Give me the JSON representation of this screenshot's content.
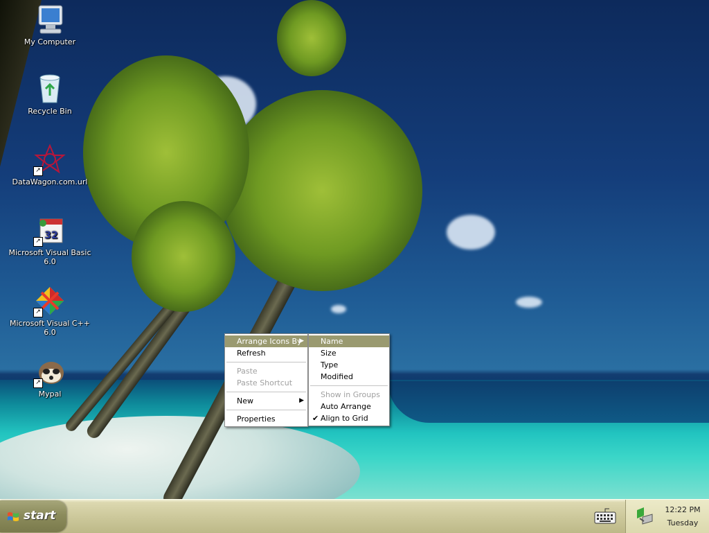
{
  "desktop": {
    "icons": [
      {
        "label": "My Computer",
        "icon": "my-computer-icon",
        "shortcut": false
      },
      {
        "label": "Recycle Bin",
        "icon": "recycle-bin-icon",
        "shortcut": false
      },
      {
        "label": "DataWagon.com.url",
        "icon": "datawagon-icon",
        "shortcut": true
      },
      {
        "label": "Microsoft Visual Basic 6.0",
        "icon": "visual-basic-icon",
        "shortcut": true
      },
      {
        "label": "Microsoft Visual C++ 6.0",
        "icon": "visual-cpp-icon",
        "shortcut": true
      },
      {
        "label": "Mypal",
        "icon": "mypal-icon",
        "shortcut": true
      }
    ]
  },
  "context_menu": {
    "items": [
      {
        "label": "Arrange Icons By",
        "submenu": true,
        "state": "highlighted"
      },
      {
        "label": "Refresh"
      },
      {
        "label": "Paste",
        "state": "disabled"
      },
      {
        "label": "Paste Shortcut",
        "state": "disabled"
      },
      {
        "label": "New",
        "submenu": true
      },
      {
        "label": "Properties"
      }
    ]
  },
  "arrange_submenu": {
    "items": [
      {
        "label": "Name",
        "state": "highlighted"
      },
      {
        "label": "Size"
      },
      {
        "label": "Type"
      },
      {
        "label": "Modified"
      },
      {
        "label": "Show in Groups",
        "state": "disabled"
      },
      {
        "label": "Auto Arrange"
      },
      {
        "label": "Align to Grid",
        "checked": true
      }
    ]
  },
  "taskbar": {
    "start_label": "start",
    "tray_icons": [
      "keyboard-icon",
      "network-icon"
    ],
    "clock_time": "12:22 PM",
    "clock_day": "Tuesday"
  },
  "colors": {
    "menu_highlight": "#9a9a70",
    "taskbar": "#cdc99c",
    "start_button": "#8c8c5c"
  }
}
